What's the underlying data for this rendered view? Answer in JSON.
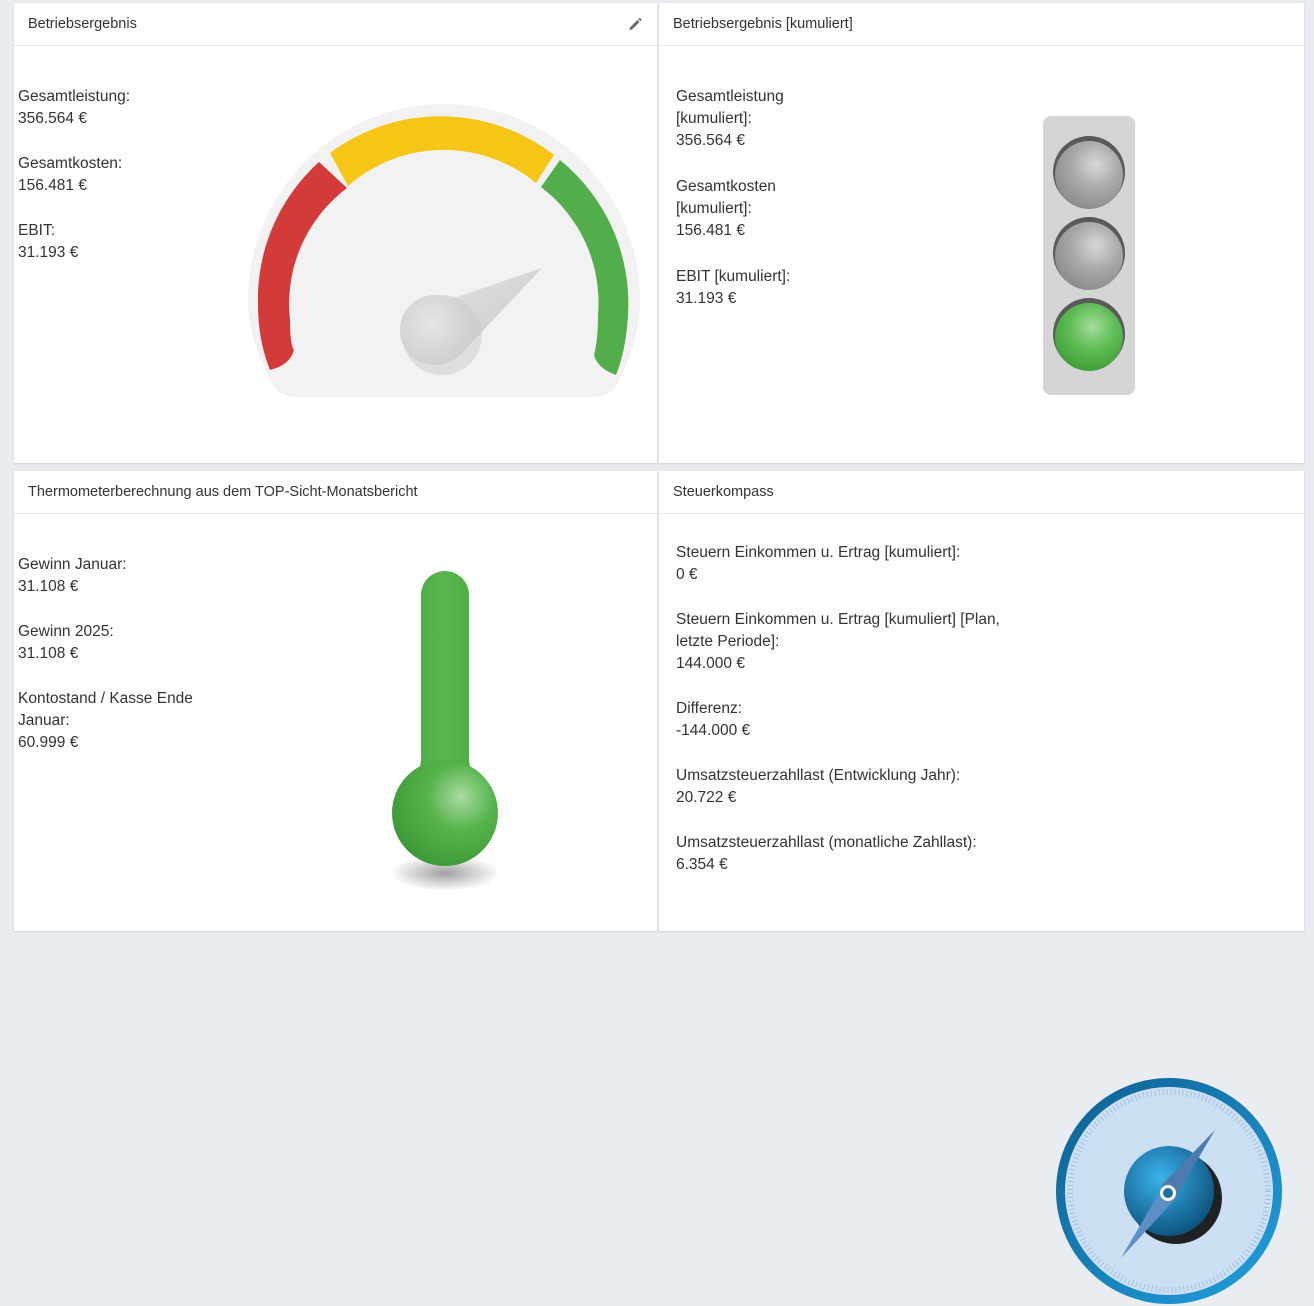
{
  "panels": {
    "betriebsergebnis": {
      "title": "Betriebsergebnis",
      "items": [
        {
          "label": "Gesamtleistung:",
          "value": "356.564 €"
        },
        {
          "label": "Gesamtkosten:",
          "value": "156.481 €"
        },
        {
          "label": "EBIT:",
          "value": "31.193 €"
        }
      ],
      "gauge_level": 0.72,
      "colors": {
        "red": "#d33a3a",
        "yellow": "#f6c516",
        "green": "#52ae4b"
      }
    },
    "kumuliert": {
      "title": "Betriebsergebnis [kumuliert]",
      "items": [
        {
          "label": "Gesamtleistung [kumuliert]:",
          "value": "356.564 €"
        },
        {
          "label": "Gesamtkosten [kumuliert]:",
          "value": "156.481 €"
        },
        {
          "label": "EBIT [kumuliert]:",
          "value": "31.193 €"
        }
      ],
      "traffic_light_active": "green"
    },
    "thermometer": {
      "title": "Thermometerberechnung aus dem TOP-Sicht-Monatsbericht",
      "items": [
        {
          "label": "Gewinn Januar:",
          "value": "31.108 €"
        },
        {
          "label": "Gewinn 2025:",
          "value": "31.108 €"
        },
        {
          "label": "Kontostand / Kasse Ende Januar:",
          "value": "60.999 €"
        }
      ],
      "color": "#52ae4b"
    },
    "steuerkompass": {
      "title": "Steuerkompass",
      "items": [
        {
          "label": "Steuern Einkommen u. Ertrag [kumuliert]:",
          "value": "0 €"
        },
        {
          "label": "Steuern Einkommen u. Ertrag [kumuliert] [Plan, letzte Periode]:",
          "value": "144.000 €"
        },
        {
          "label": "Differenz:",
          "value": "-144.000 €"
        },
        {
          "label": "Umsatzsteuerzahllast (Entwicklung Jahr):",
          "value": "20.722 €"
        },
        {
          "label": "Umsatzsteuerzahllast (monatliche Zahllast):",
          "value": "6.354 €"
        }
      ],
      "color": "#1a7fba"
    }
  }
}
